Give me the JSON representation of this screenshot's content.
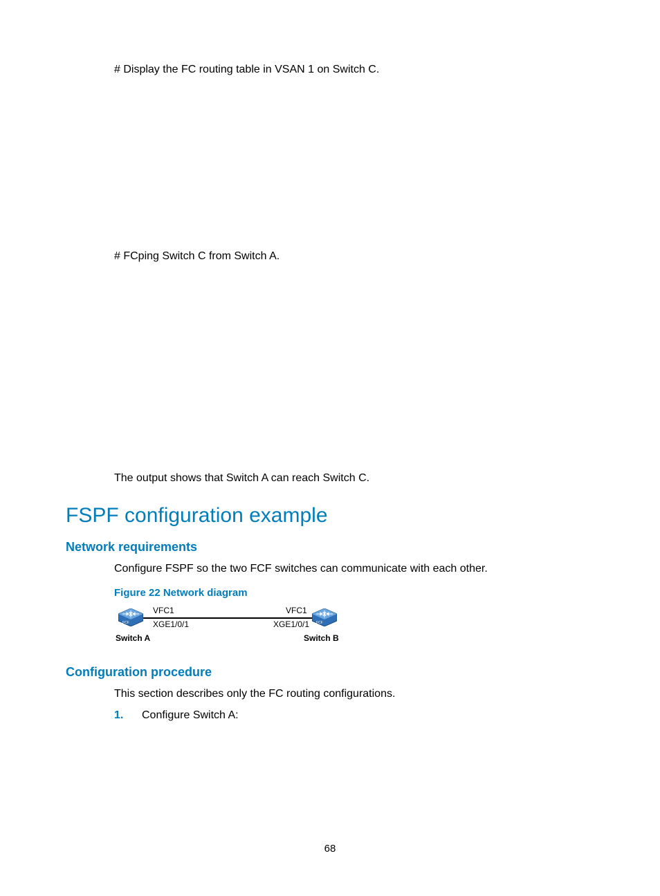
{
  "paragraphs": {
    "p1": "# Display the FC routing table in VSAN 1 on Switch C.",
    "p2": "# FCping Switch C from Switch A.",
    "p3": "The output shows that Switch A can reach Switch C."
  },
  "headings": {
    "h1": "FSPF configuration example",
    "net_req": "Network requirements",
    "conf_proc": "Configuration procedure"
  },
  "network": {
    "text": "Configure FSPF so the two FCF switches can communicate with each other.",
    "figure_caption": "Figure 22 Network diagram",
    "diagram": {
      "vfc_left": "VFC1",
      "xge_left": "XGE1/0/1",
      "vfc_right": "VFC1",
      "xge_right": "XGE1/0/1",
      "switch_a": "Switch A",
      "switch_b": "Switch B"
    }
  },
  "procedure": {
    "intro": "This section describes only the FC routing configurations.",
    "steps": {
      "s1": "Configure Switch A:"
    }
  },
  "page_number": "68"
}
